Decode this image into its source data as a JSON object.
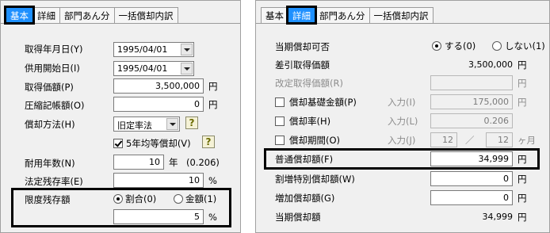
{
  "left_panel": {
    "tabs": [
      "基本",
      "詳細",
      "部門あん分",
      "一括償却内訳"
    ],
    "acquisition_date_label": "取得年月日(Y)",
    "acquisition_date_value": "1995/04/01",
    "service_start_label": "供用開始日(I)",
    "service_start_value": "1995/04/01",
    "acquisition_price_label": "取得価額(P)",
    "acquisition_price_value": "3,500,000",
    "compressed_book_label": "圧縮記帳額(O)",
    "compressed_book_value": "0",
    "yen": "円",
    "method_label": "償却方法(H)",
    "method_value": "旧定率法",
    "help_glyph": "?",
    "five_year_label": "5年均等償却(V)",
    "useful_life_label": "耐用年数(N)",
    "useful_life_value": "10",
    "year_unit": "年",
    "rate_display": "(0.206)",
    "residual_rate_label": "法定残存率(E)",
    "residual_rate_value": "10",
    "percent": "%",
    "limit_residual_label": "限度残存額",
    "ratio_label": "割合(0)",
    "amount_label": "金額(1)",
    "limit_value": "5"
  },
  "right_panel": {
    "tabs": [
      "基本",
      "詳細",
      "部門あん分",
      "一括償却内訳"
    ],
    "current_dep_label": "当期償却可否",
    "yes_label": "する(0)",
    "no_label": "しない(1)",
    "net_price_label": "差引取得価額",
    "net_price_value": "3,500,000",
    "revised_price_label": "改定取得価額(R)",
    "base_amount_label": "償却基礎金額(P)",
    "base_amount_value": "175,000",
    "rate_label": "償却率(H)",
    "rate_value": "0.206",
    "period_label": "償却期間(O)",
    "period_num": "12",
    "period_sep": "／",
    "period_den": "12",
    "month_unit": "ヶ月",
    "input_label": "入力(I)",
    "input_label_L": "入力(L)",
    "input_label_J": "入力(J)",
    "normal_dep_label": "普通償却額(F)",
    "normal_dep_value": "34,999",
    "special_dep_label": "割増特別償却額(W)",
    "special_dep_value": "0",
    "additional_dep_label": "増加償却額(G)",
    "additional_dep_value": "0",
    "current_total_label": "当期償却額",
    "current_total_value": "34,999",
    "yen": "円"
  },
  "colors": {
    "active_tab": "#1e90ff",
    "panel_bg": "#f0f0f0",
    "highlight": "#000000"
  }
}
